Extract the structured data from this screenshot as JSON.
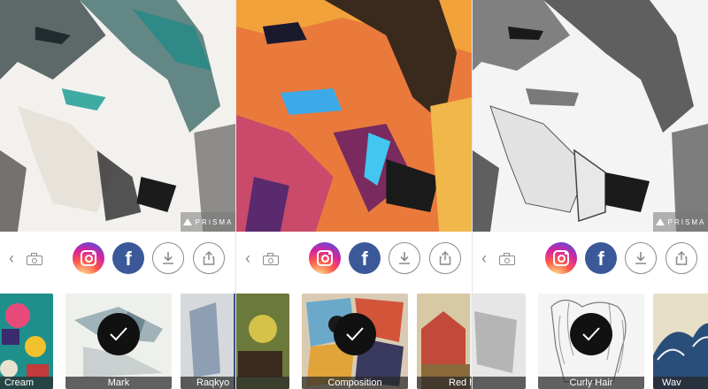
{
  "watermark": "PRISMA",
  "share_buttons": {
    "instagram": "instagram-icon",
    "facebook": "f",
    "download": "download-icon",
    "share": "share-icon"
  },
  "colors": {
    "facebook": "#3b5998",
    "icon_gray": "#8a8a8a",
    "tile_label_bg": "#282828"
  },
  "panels": [
    {
      "filters": [
        {
          "label": "Cream",
          "selected": false
        },
        {
          "label": "Mark",
          "selected": true
        },
        {
          "label": "Raqkyo",
          "selected": false
        }
      ]
    },
    {
      "filters": [
        {
          "label": "",
          "selected": false
        },
        {
          "label": "Composition",
          "selected": true
        },
        {
          "label": "Red hban",
          "selected": false
        }
      ]
    },
    {
      "filters": [
        {
          "label": "",
          "selected": false
        },
        {
          "label": "Curly Hair",
          "selected": true
        },
        {
          "label": "Wav",
          "selected": false
        }
      ]
    }
  ]
}
